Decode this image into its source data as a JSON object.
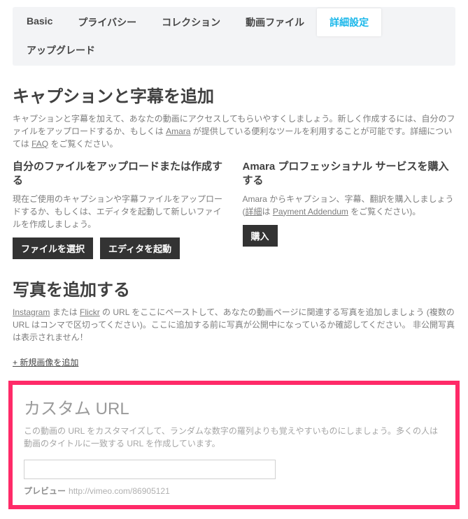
{
  "tabs": [
    {
      "label": "Basic",
      "active": false
    },
    {
      "label": "プライバシー",
      "active": false
    },
    {
      "label": "コレクション",
      "active": false
    },
    {
      "label": "動画ファイル",
      "active": false
    },
    {
      "label": "詳細設定",
      "active": true
    },
    {
      "label": "アップグレード",
      "active": false
    }
  ],
  "captions": {
    "heading": "キャプションと字幕を追加",
    "desc_1": "キャプションと字幕を加えて、あなたの動画にアクセスしてもらいやすくしましょう。新しく作成するには、自分のファイルをアップロードするか、もしくは ",
    "desc_link1": "Amara",
    "desc_2": " が提供している便利なツールを利用することが可能です。詳細については ",
    "desc_link2": "FAQ",
    "desc_3": " をご覧ください。",
    "left": {
      "heading": "自分のファイルをアップロードまたは作成する",
      "desc": "現在ご使用のキャプションや字幕ファイルをアップロードするか、もしくは、エディタを起動して新しいファイルを作成しましょう。",
      "btn1": "ファイルを選択",
      "btn2": "エディタを起動"
    },
    "right": {
      "heading": "Amara プロフェッショナル サービスを購入する",
      "desc_pre": "Amara からキャプション、字幕、翻訳を購入しましょう (",
      "desc_link": "詳細",
      "desc_mid": "は ",
      "desc_link2": "Payment Addendum",
      "desc_post": " をご覧ください)。",
      "btn": "購入"
    }
  },
  "photos": {
    "heading": "写真を追加する",
    "desc_pre": "",
    "link1": "Instagram",
    "mid1": " または ",
    "link2": "Flickr",
    "desc_post": " の URL をここにペーストして、あなたの動画ページに関連する写真を追加しましょう (複数の URL はコンマで区切ってください)。ここに追加する前に写真が公開中になっているか確認してください。 非公開写真は表示されません！",
    "add_link": "+ 新規画像を追加"
  },
  "custom_url": {
    "heading": "カスタム URL",
    "desc": "この動画の URL をカスタマイズして、ランダムな数字の羅列よりも覚えやすいものにしましょう。多くの人は動画のタイトルに一致する URL を作成しています。",
    "input_value": "",
    "preview_label": "プレビュー",
    "preview_url": "http://vimeo.com/86905121"
  }
}
